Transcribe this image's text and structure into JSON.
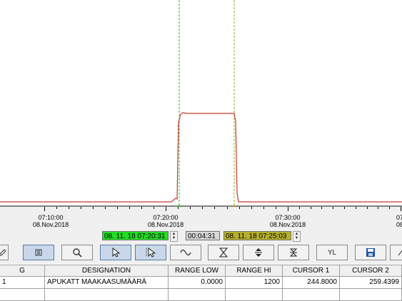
{
  "axis": {
    "labels": [
      {
        "time": "07:10:00",
        "date": "08.Nov.2018"
      },
      {
        "time": "07:20:00",
        "date": "08.Nov.2018"
      },
      {
        "time": "07:30:00",
        "date": "08.Nov.2018"
      },
      {
        "time": "07:",
        "date": "08."
      }
    ]
  },
  "cursors": {
    "cursor1_time": "08. 11. 18 07:20:31",
    "delta": "00:04:31",
    "cursor2_time": "08. 11. 18 07:25:03",
    "cursor1_color": "#22dd22",
    "cursor2_color": "#b5b02a"
  },
  "trace": {
    "color": "#c0392b"
  },
  "toolbar": {
    "icons": [
      "edit-icon",
      "pause-icon",
      "zoom-icon",
      "cursor-select-icon",
      "cursor-multi-icon",
      "sine-wave-icon",
      "hourglass-icon",
      "vertical-expand-icon",
      "compress-icon",
      "y-limits-icon",
      "save-icon",
      "export-icon"
    ],
    "yl_label": "YL"
  },
  "table": {
    "headers": [
      "G",
      "DESIGNATION",
      "RANGE LOW",
      "RANGE HI",
      "CURSOR 1",
      "CURSOR 2"
    ],
    "rows": [
      [
        "1",
        "APUKATT MAAKAASUMÄÄRÄ",
        "0.0000",
        "1200",
        "244.8000",
        "259.4399"
      ]
    ]
  }
}
